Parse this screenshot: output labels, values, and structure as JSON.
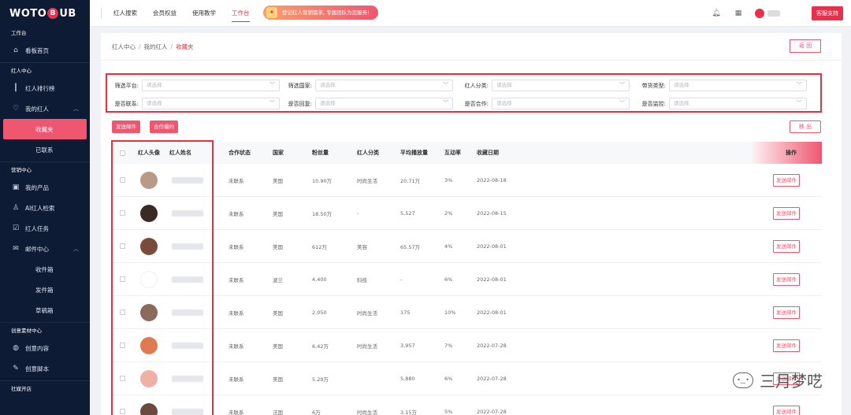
{
  "logo": {
    "pre": "WOTO",
    "ring": "B",
    "post": "UB"
  },
  "sidebar": {
    "g1": "工作台",
    "dashboard": "看板首页",
    "g2": "红人中心",
    "ranking": "红人排行榜",
    "myinfluencer": "我的红人",
    "favorites": "收藏夹",
    "contacted": "已联系",
    "g3": "营销中心",
    "products": "我的产品",
    "ai_search": "AI红人检索",
    "tasks": "红人任务",
    "mail": "邮件中心",
    "inbox": "收件箱",
    "sent": "发件箱",
    "drafts": "草稿箱",
    "g4": "创意素材中心",
    "creative": "创意内容",
    "script": "创意脚本",
    "g5": "社媒开店"
  },
  "topnav": {
    "items": [
      "红人搜索",
      "会员权益",
      "使用教学",
      "工作台"
    ],
    "promo": "登记红人营销需求, 专属团队为您服务!",
    "support": "客服支持"
  },
  "breadcrumb": {
    "a": "红人中心",
    "b": "我的红人",
    "c": "收藏夹"
  },
  "buttons": {
    "back": "返 回",
    "send_mail": "发送邮件",
    "coop": "合作撮约",
    "remove": "移 出"
  },
  "filters": {
    "platform": "筛选平台:",
    "country": "筛选国家:",
    "category": "红人分类:",
    "cargo": "带货类型:",
    "contacted": "是否联系:",
    "replied": "是否回复:",
    "cooperated": "是否合作:",
    "monitor": "是否监控:",
    "placeholder": "请选择"
  },
  "table": {
    "headers": {
      "avatar": "红人头像",
      "name": "红人姓名",
      "status": "合作状态",
      "country": "国家",
      "fans": "粉丝量",
      "category": "红人分类",
      "plays": "平均播放量",
      "engage": "互动率",
      "date": "收藏日期",
      "op": "操作"
    },
    "action": "发送邮件",
    "rows": [
      {
        "status": "未联系",
        "country": "美国",
        "fans": "10.90万",
        "category": "时尚生活",
        "plays": "20.71万",
        "engage": "3%",
        "date": "2022-08-18"
      },
      {
        "status": "未联系",
        "country": "美国",
        "fans": "18.50万",
        "category": "-",
        "plays": "5,527",
        "engage": "2%",
        "date": "2022-08-15"
      },
      {
        "status": "未联系",
        "country": "美国",
        "fans": "612万",
        "category": "美容",
        "plays": "65.57万",
        "engage": "4%",
        "date": "2022-08-01"
      },
      {
        "status": "未联系",
        "country": "波兰",
        "fans": "4,400",
        "category": "科技",
        "plays": "-",
        "engage": "6%",
        "date": "2022-08-01"
      },
      {
        "status": "未联系",
        "country": "美国",
        "fans": "2,050",
        "category": "时尚生活",
        "plays": "175",
        "engage": "10%",
        "date": "2022-08-01"
      },
      {
        "status": "未联系",
        "country": "美国",
        "fans": "6.42万",
        "category": "时尚生活",
        "plays": "3,957",
        "engage": "7%",
        "date": "2022-07-28"
      },
      {
        "status": "未联系",
        "country": "美国",
        "fans": "5.29万",
        "category": "",
        "plays": "5,880",
        "engage": "6%",
        "date": "2022-07-28"
      },
      {
        "status": "未联系",
        "country": "法国",
        "fans": "6万",
        "category": "时尚生活",
        "plays": "3.15万",
        "engage": "5%",
        "date": "2022-07-28"
      }
    ]
  },
  "watermark": "三月梦呓",
  "colors": {
    "accent": "#ef5670",
    "sidebar": "#0e1b35",
    "highlight": "#e8303f"
  }
}
